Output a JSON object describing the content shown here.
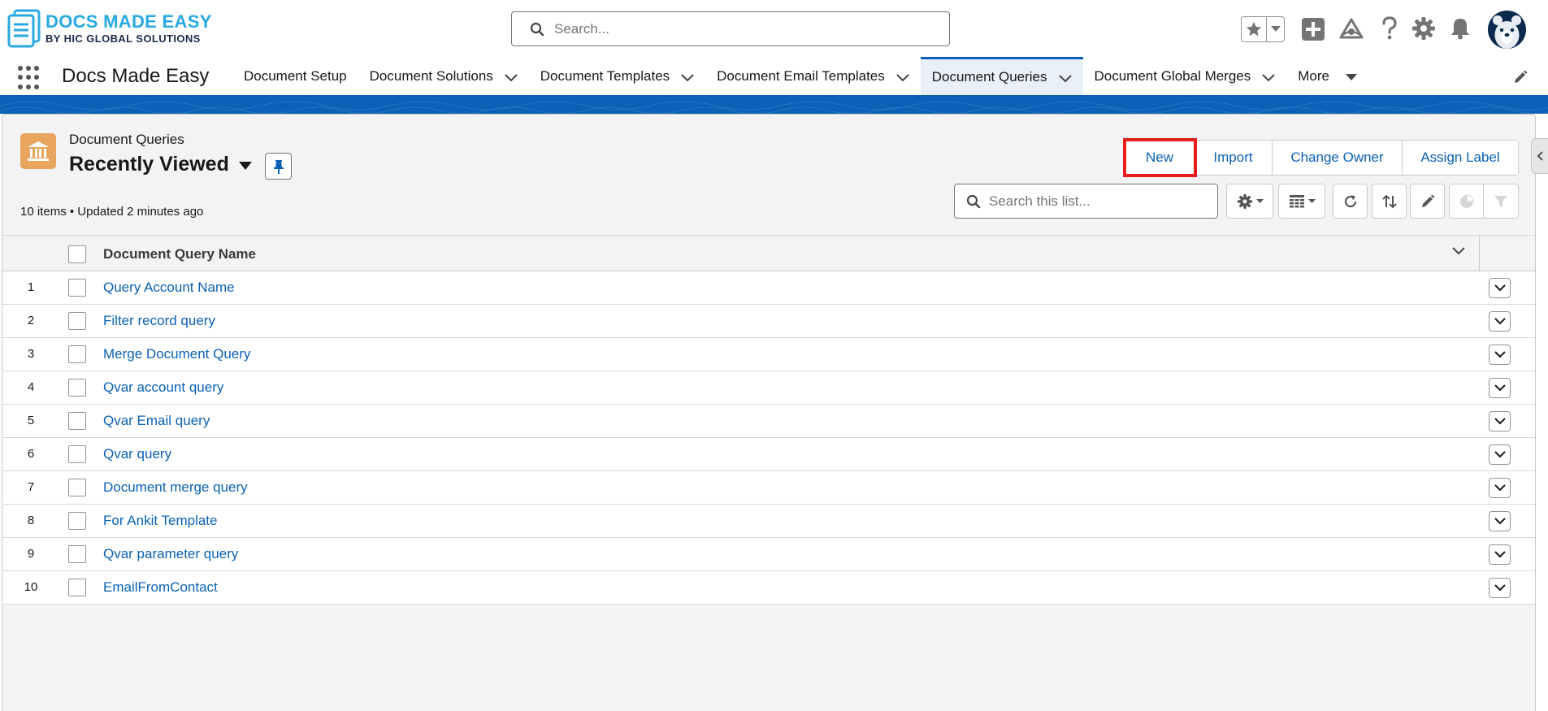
{
  "brand": {
    "line1": "DOCS MADE EASY",
    "line2": "BY HIC GLOBAL SOLUTIONS"
  },
  "global_search": {
    "placeholder": "Search..."
  },
  "header_icons": [
    "star-icon",
    "chevron-down-icon",
    "add-icon",
    "trailhead-icon",
    "help-icon",
    "setup-gear-icon",
    "notification-bell-icon",
    "avatar"
  ],
  "app": {
    "name": "Docs Made Easy",
    "nav": [
      {
        "label": "Document Setup",
        "dropdown": false
      },
      {
        "label": "Document Solutions",
        "dropdown": true
      },
      {
        "label": "Document Templates",
        "dropdown": true
      },
      {
        "label": "Document Email Templates",
        "dropdown": true
      },
      {
        "label": "Document Queries",
        "dropdown": true,
        "active": true
      },
      {
        "label": "Document Global Merges",
        "dropdown": true
      },
      {
        "label": "More",
        "dropdown": true
      }
    ]
  },
  "list_view": {
    "object_name": "Document Queries",
    "title": "Recently Viewed",
    "meta": "10 items • Updated 2 minutes ago",
    "actions": {
      "new": "New",
      "import": "Import",
      "change_owner": "Change Owner",
      "assign_label": "Assign Label"
    },
    "search_placeholder": "Search this list...",
    "column_header": "Document Query Name",
    "rows": [
      {
        "num": "1",
        "name": "Query Account Name"
      },
      {
        "num": "2",
        "name": "Filter record query"
      },
      {
        "num": "3",
        "name": "Merge Document Query"
      },
      {
        "num": "4",
        "name": "Qvar account query"
      },
      {
        "num": "5",
        "name": "Qvar Email query"
      },
      {
        "num": "6",
        "name": "Qvar query"
      },
      {
        "num": "7",
        "name": "Document merge query"
      },
      {
        "num": "8",
        "name": "For Ankit Template"
      },
      {
        "num": "9",
        "name": "Qvar parameter query"
      },
      {
        "num": "10",
        "name": "EmailFromContact"
      }
    ]
  },
  "colors": {
    "brand_blue": "#0a61b5",
    "object_icon": "#e7a55e",
    "highlight_red": "#e41d1d"
  }
}
